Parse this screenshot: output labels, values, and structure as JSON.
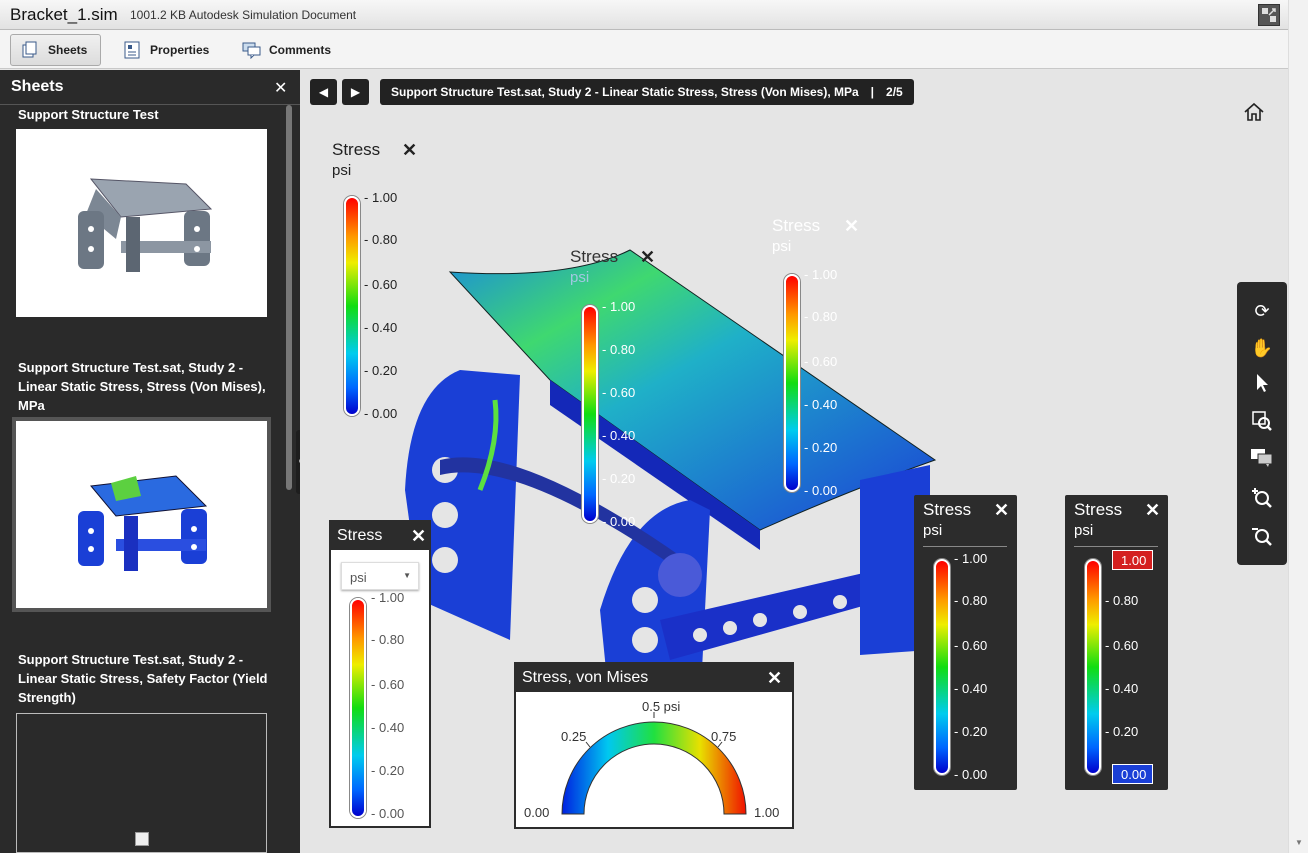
{
  "window": {
    "file_name": "Bracket_1.sim",
    "file_info": "1001.2 KB Autodesk Simulation Document",
    "expand_icon": "expand-icon"
  },
  "tabs": [
    {
      "label": "Sheets",
      "icon": "sheets-icon",
      "active": true
    },
    {
      "label": "Properties",
      "icon": "properties-icon",
      "active": false
    },
    {
      "label": "Comments",
      "icon": "comments-icon",
      "active": false
    }
  ],
  "sidebar": {
    "title": "Sheets",
    "close_icon": "close-icon",
    "sheets": [
      {
        "title": "Support Structure Test"
      },
      {
        "title": "Support Structure Test.sat, Study 2 - Linear Static Stress, Stress (Von Mises), MPa",
        "selected": true
      },
      {
        "title": "Support Structure Test.sat, Study 2 - Linear Static Stress, Safety Factor (Yield Strength)"
      }
    ]
  },
  "viewer": {
    "sheet_title": "Support Structure Test.sat, Study 2 - Linear Static Stress, Stress (Von Mises), MPa",
    "separator": "|",
    "page": "2/5",
    "prev_icon": "prev-arrow-icon",
    "next_icon": "next-arrow-icon",
    "home_icon": "home-icon"
  },
  "toolbar": {
    "tools": [
      "rotate-icon",
      "pan-hand-icon",
      "select-pointer-icon",
      "zoom-window-icon",
      "comments-icon",
      "zoom-in-icon",
      "zoom-out-icon"
    ]
  },
  "legends": {
    "ticks": [
      "1.00",
      "0.80",
      "0.60",
      "0.40",
      "0.20",
      "0.00"
    ],
    "title": "Stress",
    "unit": "psi",
    "gauge_title": "Stress, von Mises",
    "gauge_labels": {
      "min": "0.00",
      "q1": "0.25",
      "mid": "0.5 psi",
      "q3": "0.75",
      "max": "1.00"
    },
    "flag_max": "1.00",
    "flag_min": "0.00"
  },
  "colors": {
    "sidebar_bg": "#2a2a2a",
    "viewer_bg": "#e5e5e5",
    "panel_dark": "#2c2c2c",
    "max_flag": "#d42020",
    "min_flag": "#1a3fd6"
  }
}
